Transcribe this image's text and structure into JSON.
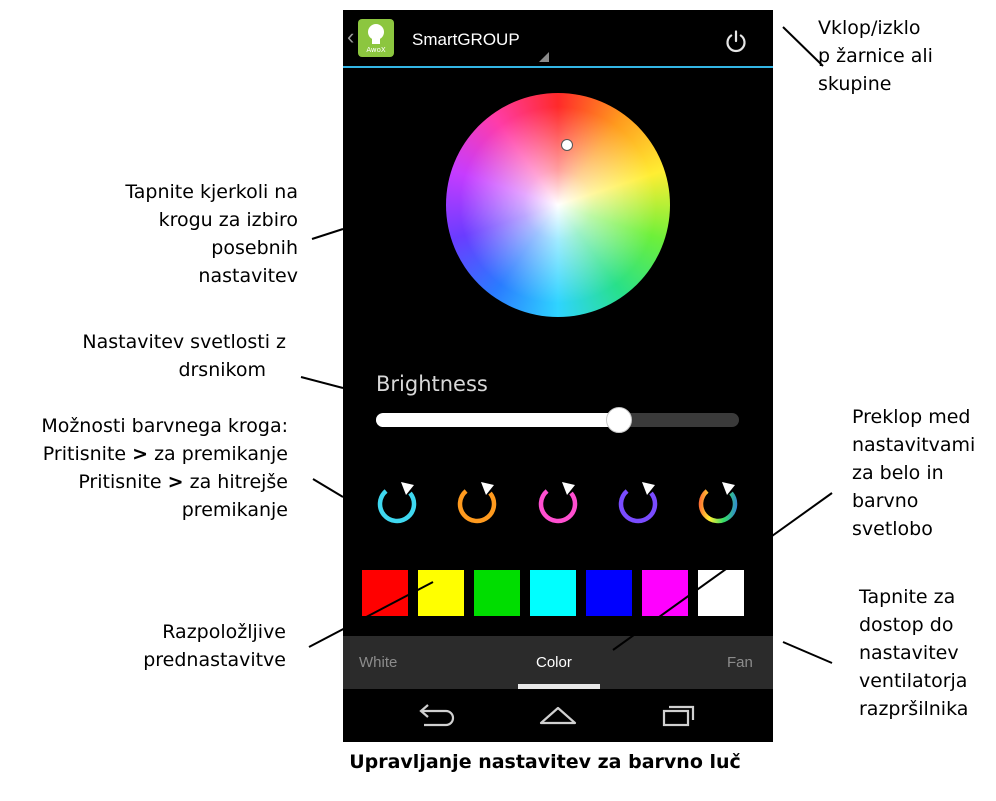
{
  "app": {
    "group_name": "SmartGROUP",
    "icon_brand": "AwoX"
  },
  "colors": {
    "accent": "#33b5e5",
    "background": "#000000",
    "tab_bar": "#2b2b2b"
  },
  "brightness": {
    "label": "Brightness",
    "level_percent": 67
  },
  "color_modes": [
    {
      "name": "mode-1"
    },
    {
      "name": "mode-2"
    },
    {
      "name": "mode-3"
    },
    {
      "name": "mode-4"
    },
    {
      "name": "mode-5"
    }
  ],
  "presets": [
    "#ff0000",
    "#ffff00",
    "#00dd00",
    "#00ffff",
    "#0000ff",
    "#ff00ff",
    "#ffffff"
  ],
  "tabs": [
    {
      "label": "White",
      "selected": false
    },
    {
      "label": "Color",
      "selected": true
    },
    {
      "label": "Fan",
      "selected": false
    }
  ],
  "navbar": {
    "icons": [
      "back-icon",
      "home-icon",
      "recents-icon"
    ]
  },
  "annotations": {
    "power": [
      "Vklop/izklo",
      "p žarnice ali",
      "skupine"
    ],
    "wheel": [
      "Tapnite kjerkoli na",
      "krogu za izbiro",
      "posebnih",
      "nastavitev"
    ],
    "brightness": [
      "Nastavitev svetlosti z",
      "drsnikom"
    ],
    "modes_title": "Možnosti barvnega kroga:",
    "modes_line_a_pre": "Pritisnite ",
    "modes_line_a_sym": ">",
    "modes_line_a_post": " za premikanje",
    "modes_line_b_pre": "Pritisnite ",
    "modes_line_b_sym": ">",
    "modes_line_b_post": " za hitrejše",
    "modes_line_c": "premikanje",
    "presets": [
      "Razpoložljive",
      "prednastavitve"
    ],
    "tabs_switch": [
      "Preklop med",
      "nastavitvami",
      "za belo in",
      "barvno",
      "svetlobo"
    ],
    "fan": [
      "Tapnite za",
      "dostop do",
      "nastavitev",
      "ventilatorja",
      "razpršilnika"
    ]
  },
  "caption": "Upravljanje nastavitev za barvno luč"
}
